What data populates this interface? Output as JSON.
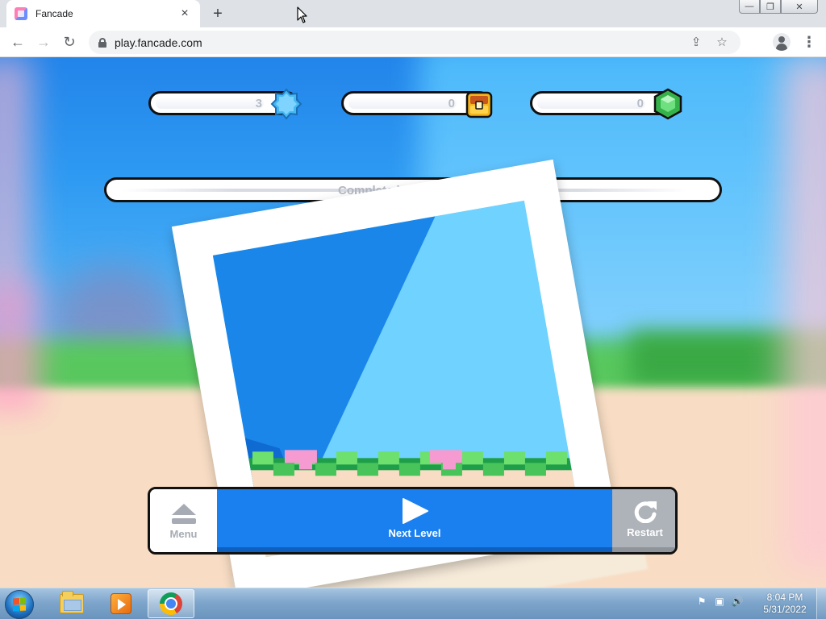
{
  "browser": {
    "tab_title": "Fancade",
    "tab_close": "×",
    "new_tab": "+",
    "url": "play.fancade.com",
    "window_controls": {
      "minimize": "—",
      "restore": "❐",
      "close": "✕"
    },
    "nav": {
      "back": "←",
      "forward": "→",
      "reload": "↻",
      "menu": "⋮"
    },
    "omnibox_icons": {
      "share": "share-icon",
      "bookmark": "star-icon"
    }
  },
  "game": {
    "currencies": [
      {
        "name": "stars",
        "value": "3",
        "icon": "star-badge-icon",
        "color": "#45b8f3"
      },
      {
        "name": "chests",
        "value": "0",
        "icon": "treasure-chest-icon",
        "color": "#f2b41d"
      },
      {
        "name": "gems",
        "value": "0",
        "icon": "gem-icon",
        "color": "#35b34a"
      }
    ],
    "progress": {
      "text": "Complete level to earn 2★",
      "fill_fraction": 0
    },
    "buttons": {
      "menu": "Menu",
      "next": "Next Level",
      "restart": "Restart"
    },
    "colors": {
      "next_bg": "#1a80f0",
      "restart_bg": "#aeb2b9",
      "sky": "#2e9af2"
    }
  },
  "taskbar": {
    "clock_time": "8:04 PM",
    "clock_date": "5/31/2022",
    "apps": [
      "file-explorer-icon",
      "media-player-icon",
      "chrome-icon"
    ]
  }
}
